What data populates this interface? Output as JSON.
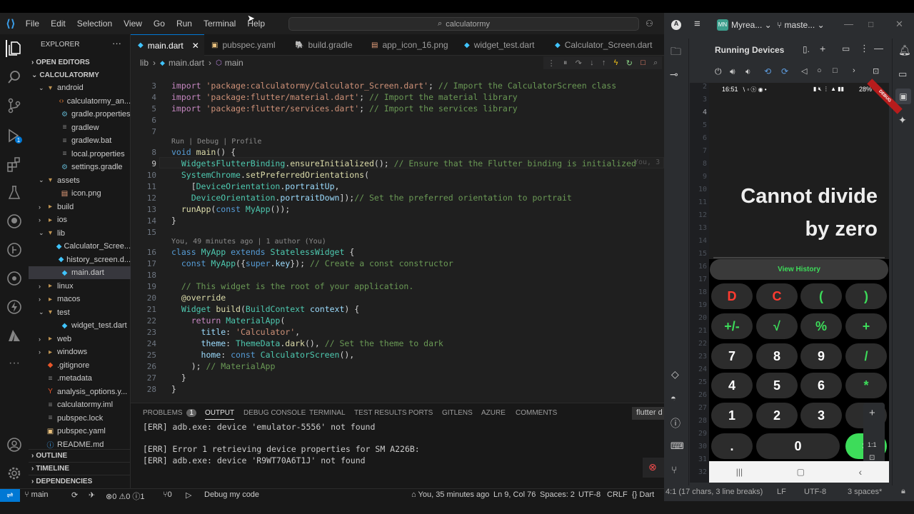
{
  "menu": [
    "File",
    "Edit",
    "Selection",
    "View",
    "Go",
    "Run",
    "Terminal",
    "Help"
  ],
  "command_center": "calculatormy",
  "explorer": {
    "title": "EXPLORER",
    "open_editors": "OPEN EDITORS",
    "root": "CALCULATORMY",
    "items": [
      {
        "label": "android",
        "type": "folder-open",
        "depth": 1
      },
      {
        "label": "calculatormy_an...",
        "type": "xml",
        "depth": 2
      },
      {
        "label": "gradle.properties",
        "type": "gradle",
        "depth": 2
      },
      {
        "label": "gradlew",
        "type": "file",
        "depth": 2
      },
      {
        "label": "gradlew.bat",
        "type": "file",
        "depth": 2
      },
      {
        "label": "local.properties",
        "type": "file",
        "depth": 2
      },
      {
        "label": "settings.gradle",
        "type": "gradle",
        "depth": 2
      },
      {
        "label": "assets",
        "type": "folder-open",
        "depth": 1
      },
      {
        "label": "icon.png",
        "type": "image",
        "depth": 2
      },
      {
        "label": "build",
        "type": "folder",
        "depth": 1
      },
      {
        "label": "ios",
        "type": "folder",
        "depth": 1
      },
      {
        "label": "lib",
        "type": "folder-open",
        "depth": 1
      },
      {
        "label": "Calculator_Scree...",
        "type": "dart",
        "depth": 2
      },
      {
        "label": "history_screen.d...",
        "type": "dart",
        "depth": 2
      },
      {
        "label": "main.dart",
        "type": "dart",
        "depth": 2,
        "selected": true
      },
      {
        "label": "linux",
        "type": "folder",
        "depth": 1
      },
      {
        "label": "macos",
        "type": "folder",
        "depth": 1
      },
      {
        "label": "test",
        "type": "folder-open",
        "depth": 1
      },
      {
        "label": "widget_test.dart",
        "type": "dart",
        "depth": 2
      },
      {
        "label": "web",
        "type": "folder",
        "depth": 1
      },
      {
        "label": "windows",
        "type": "folder",
        "depth": 1
      },
      {
        "label": ".gitignore",
        "type": "git",
        "depth": 1
      },
      {
        "label": ".metadata",
        "type": "file",
        "depth": 1
      },
      {
        "label": "analysis_options.y...",
        "type": "yaml-red",
        "depth": 1
      },
      {
        "label": "calculatormy.iml",
        "type": "file",
        "depth": 1
      },
      {
        "label": "pubspec.lock",
        "type": "file",
        "depth": 1
      },
      {
        "label": "pubspec.yaml",
        "type": "yaml",
        "depth": 1
      },
      {
        "label": "README.md",
        "type": "md",
        "depth": 1
      }
    ],
    "outline": "OUTLINE",
    "timeline": "TIMELINE",
    "dependencies": "DEPENDENCIES"
  },
  "tabs": [
    "main.dart",
    "pubspec.yaml",
    "build.gradle",
    "app_icon_16.png",
    "widget_test.dart",
    "Calculator_Screen.dart"
  ],
  "breadcrumb": {
    "folder": "lib",
    "file": "main.dart",
    "symbol": "main"
  },
  "code_lens": {
    "run": "Run | Debug | Profile",
    "blame": "You, 49 minutes ago | 1 author (You)",
    "inline_blame": "You, 3"
  },
  "line_numbers": [
    "3",
    "4",
    "5",
    "6",
    "7",
    "8",
    "9",
    "10",
    "11",
    "12",
    "13",
    "14",
    "15",
    "16",
    "17",
    "18",
    "19",
    "20",
    "21",
    "22",
    "23",
    "24",
    "25",
    "26",
    "27",
    "28"
  ],
  "panel": {
    "tabs": [
      "PROBLEMS",
      "OUTPUT",
      "DEBUG CONSOLE",
      "TERMINAL",
      "TEST RESULTS",
      "PORTS",
      "GITLENS",
      "AZURE",
      "COMMENTS"
    ],
    "problems_count": "1",
    "channel": "flutter d",
    "lines": [
      "[ERR] adb.exe: device 'emulator-5556' not found",
      "",
      "[ERR] Error 1 retrieving device properties for SM A226B:",
      "[ERR] adb.exe: device 'R9WT70A6T1J' not found"
    ]
  },
  "status": {
    "branch": "main",
    "problems": "⊗0 ⚠0 ⓘ1",
    "ports": "⑂0",
    "debug": "Debug my code",
    "blame": "You, 35 minutes ago",
    "position": "Ln 9, Col 76",
    "spaces": "Spaces: 2",
    "encoding": "UTF-8",
    "eol": "CRLF",
    "language": "Dart"
  },
  "android_studio": {
    "project": "Myrea...",
    "branch": "maste...",
    "panel_title": "Running Devices",
    "gutter_lines": [
      "2",
      "3",
      "4",
      "5",
      "6",
      "7",
      "8",
      "9",
      "10",
      "11",
      "12",
      "13",
      "14",
      "15",
      "16",
      "17",
      "18",
      "19",
      "20",
      "21",
      "22",
      "23",
      "24",
      "25",
      "26",
      "27",
      "28",
      "29",
      "30",
      "31",
      "32"
    ],
    "status_left": "4:1 (17 chars, 3 line breaks)",
    "status_lf": "LF",
    "status_enc": "UTF-8",
    "status_indent": "3 spaces*",
    "zoom_ratio": "1:1"
  },
  "phone": {
    "time": "16:51",
    "battery": "28%",
    "debug_banner": "DEBUG",
    "display_line1": "Cannot divide",
    "display_line2": "by zero",
    "history_button": "View History",
    "keys": [
      [
        "D",
        "C",
        "(",
        ")"
      ],
      [
        "+/-",
        "√",
        "%",
        "+"
      ],
      [
        "7",
        "8",
        "9",
        "/"
      ],
      [
        "4",
        "5",
        "6",
        "*"
      ],
      [
        "1",
        "2",
        "3",
        "-"
      ],
      [
        ".",
        "0",
        "="
      ]
    ]
  }
}
